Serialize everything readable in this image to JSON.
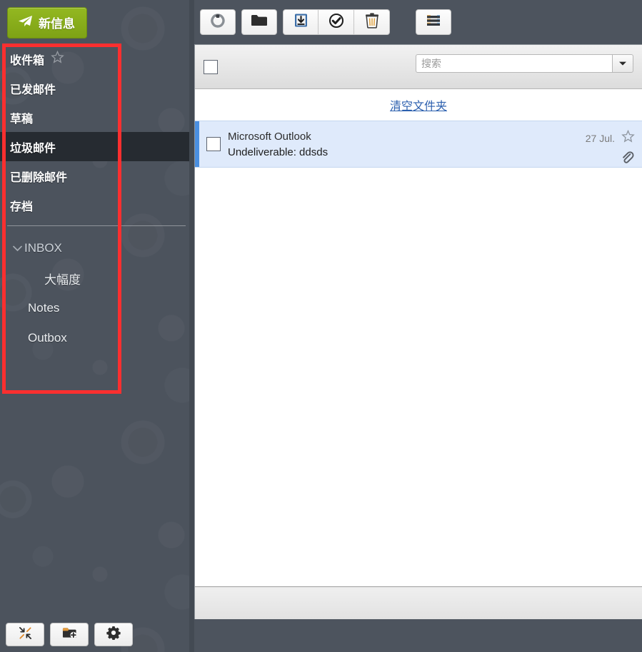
{
  "sidebar": {
    "compose": {
      "label": "新信息",
      "icon": "paper-plane-icon",
      "color": "#8cb11d"
    },
    "folders": [
      {
        "label": "收件箱",
        "starred": true,
        "selected": false
      },
      {
        "label": "已发邮件",
        "starred": false,
        "selected": false
      },
      {
        "label": "草稿",
        "starred": false,
        "selected": false
      },
      {
        "label": "垃圾邮件",
        "starred": false,
        "selected": true
      },
      {
        "label": "已删除邮件",
        "starred": false,
        "selected": false
      },
      {
        "label": "存档",
        "starred": false,
        "selected": false
      }
    ],
    "tree": [
      {
        "label": "INBOX",
        "level": 0,
        "caret": "chevron-down-icon"
      },
      {
        "label": "大幅度",
        "level": 2,
        "caret": ""
      },
      {
        "label": "Notes",
        "level": 1,
        "caret": ""
      },
      {
        "label": "Outbox",
        "level": 1,
        "caret": ""
      }
    ],
    "footer_buttons": [
      {
        "name": "collapse-button",
        "icon": "collapse-arrows-icon"
      },
      {
        "name": "add-folder-button",
        "icon": "folder-plus-icon"
      },
      {
        "name": "settings-button",
        "icon": "gear-icon"
      }
    ],
    "highlight_color": "#fb2f2f",
    "selected_row_color": "#262b31"
  },
  "toolbar": {
    "groups": [
      [
        {
          "name": "refresh-button",
          "icon": "refresh-circle-icon"
        }
      ],
      [
        {
          "name": "folder-button",
          "icon": "folder-icon"
        }
      ],
      [
        {
          "name": "archive-button",
          "icon": "archive-box-icon"
        },
        {
          "name": "mark-read-button",
          "icon": "check-circle-icon"
        },
        {
          "name": "delete-button",
          "icon": "trash-icon"
        }
      ],
      [
        {
          "name": "more-menu-button",
          "icon": "hamburger-icon"
        }
      ]
    ]
  },
  "list": {
    "select_all_checked": false,
    "search": {
      "value": "",
      "placeholder": "搜索"
    },
    "search_dropdown_icon": "caret-down-icon",
    "purge_link": "清空文件夹",
    "messages": [
      {
        "from": "Microsoft Outlook",
        "subject": "Undeliverable: ddsds",
        "date": "27 Jul.",
        "checked": false,
        "flagged": false,
        "has_attachment": true,
        "selected": true
      }
    ]
  }
}
